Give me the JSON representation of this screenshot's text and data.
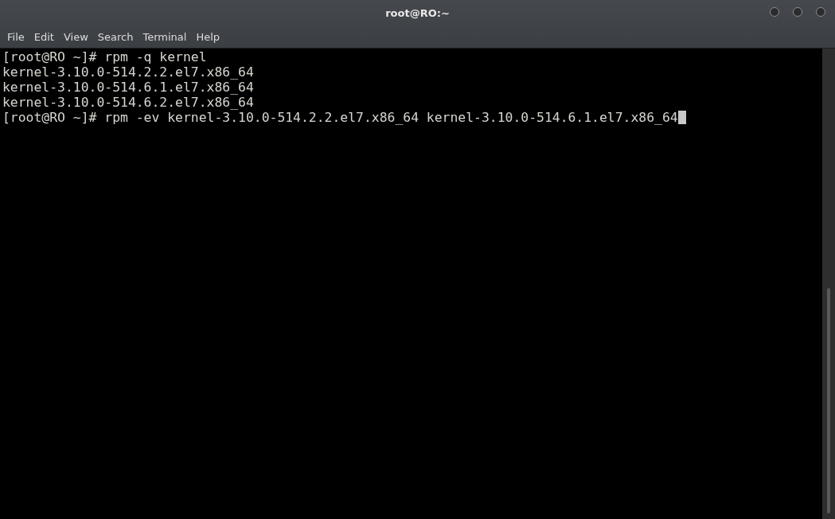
{
  "window": {
    "title": "root@RO:~"
  },
  "menu": [
    "File",
    "Edit",
    "View",
    "Search",
    "Terminal",
    "Help"
  ],
  "terminal": {
    "lines": [
      "[root@RO ~]# rpm -q kernel",
      "kernel-3.10.0-514.2.2.el7.x86_64",
      "kernel-3.10.0-514.6.1.el7.x86_64",
      "kernel-3.10.0-514.6.2.el7.x86_64",
      "[root@RO ~]# rpm -ev kernel-3.10.0-514.2.2.el7.x86_64 kernel-3.10.0-514.6.1.el7.x86_64"
    ]
  }
}
